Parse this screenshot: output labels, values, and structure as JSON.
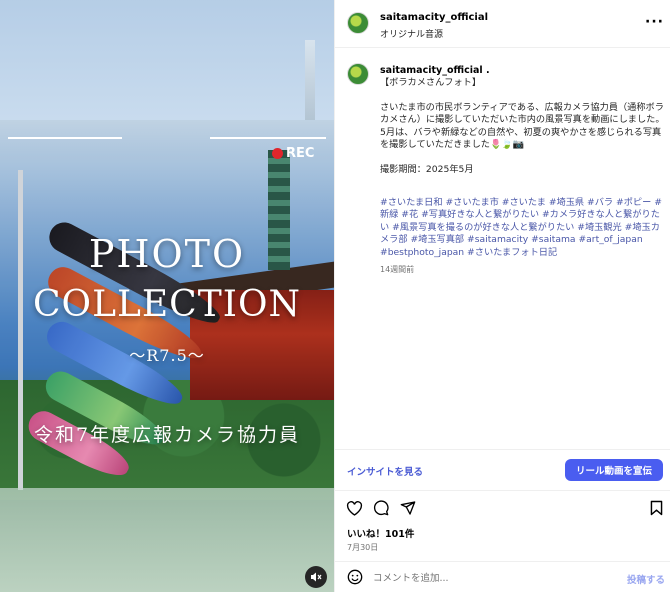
{
  "media": {
    "rec_label": "REC",
    "title_line1": "PHOTO",
    "title_line2": "COLLECTION",
    "subtitle": "～R7.5～",
    "caption": "令和7年度広報カメラ協力員"
  },
  "header": {
    "username": "saitamacity_official",
    "audio": "オリジナル音源"
  },
  "caption": {
    "username": "saitamacity_official .",
    "body": "【ボラカメさんフォト】\n\nさいたま市の市民ボランティアである、広報カメラ協力員（通称ボラカメさん）に撮影していただいた市内の風景写真を動画にしました。\n5月は、バラや新緑などの自然や、初夏の爽やかさを感じられる写真を撮影していただきました🌷🍃📷\n\n撮影期間：2025年5月",
    "hashtags": "#さいたま日和 #さいたま市 #さいたま #埼玉県 #バラ #ポピー #新緑 #花 #写真好きな人と繋がりたい #カメラ好きな人と繋がりたい #風景写真を撮るのが好きな人と繋がりたい #埼玉観光 #埼玉カメラ部 #埼玉写真部 #saitamacity #saitama #art_of_japan #bestphoto_japan #さいたまフォト日記",
    "time_ago": "14週間前"
  },
  "insight": {
    "link": "インサイトを見る",
    "promote": "リール動画を宣伝"
  },
  "actions": {
    "likes": "いいね！101件",
    "date": "7月30日"
  },
  "comment": {
    "placeholder": "コメントを追加...",
    "post": "投稿する"
  },
  "colors": {
    "accent": "#4a5df0",
    "hashtag": "#4a57a8",
    "rec_dot": "#e0262b"
  }
}
